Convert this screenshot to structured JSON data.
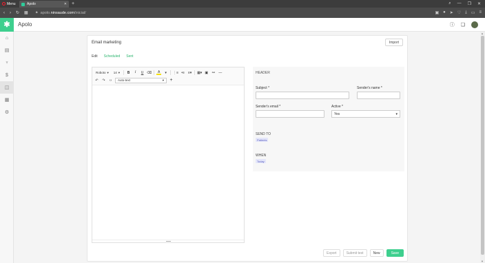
{
  "browser": {
    "menu_label": "Menu",
    "tab_title": "Apolo",
    "url_prefix": "apolo.",
    "url_domain": "ninsaude.com",
    "url_path": "/inicial/"
  },
  "app": {
    "name": "Apolo",
    "accent": "#3ecf8e"
  },
  "card": {
    "title": "Email marketing",
    "import_label": "Import",
    "tabs": [
      "Edit",
      "Scheduled",
      "Sent"
    ]
  },
  "editor": {
    "font": "Roboto",
    "size": "14",
    "autotext_placeholder": "Auto-text"
  },
  "form": {
    "header_label": "HEADER",
    "subject_label": "Subject *",
    "sender_name_label": "Sender's name *",
    "sender_email_label": "Sender's email *",
    "active_label": "Active *",
    "active_value": "Yes"
  },
  "send_to": {
    "title": "SEND TO",
    "chip": "Patients"
  },
  "when": {
    "title": "WHEN",
    "chip": "Today"
  },
  "actions": {
    "export": "Export",
    "submit_test": "Submit test",
    "new": "New",
    "save": "Save"
  }
}
